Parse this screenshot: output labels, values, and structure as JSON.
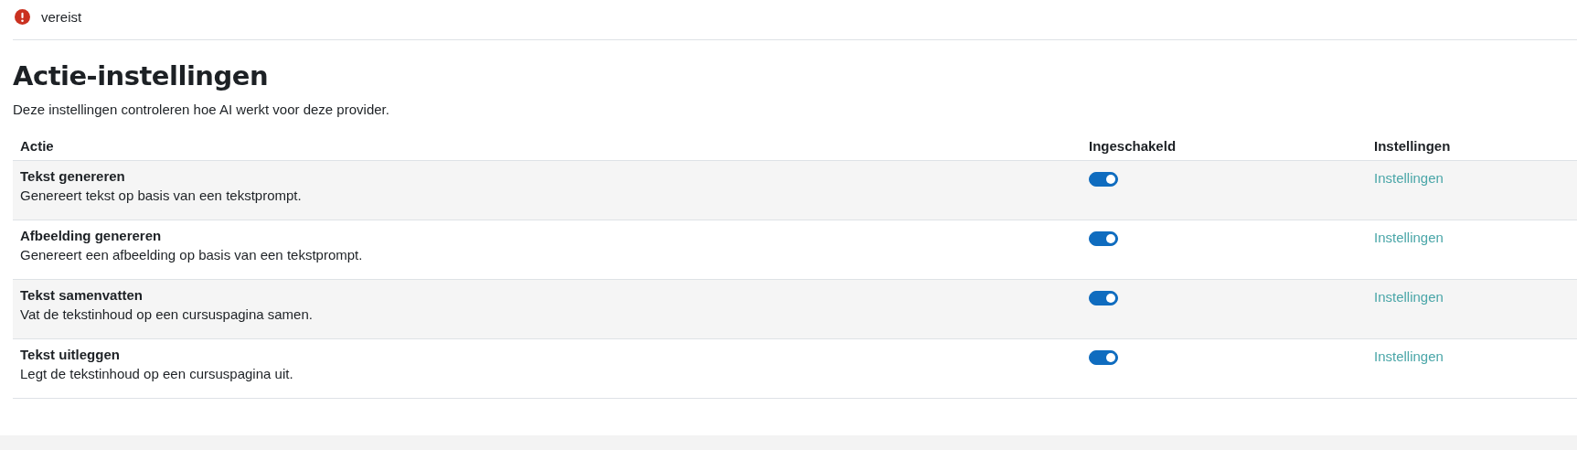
{
  "required_notice": {
    "label": "vereist"
  },
  "section": {
    "title": "Actie-instellingen",
    "description": "Deze instellingen controleren hoe AI werkt voor deze provider."
  },
  "table": {
    "columns": [
      "Actie",
      "Ingeschakeld",
      "Instellingen"
    ],
    "rows": [
      {
        "name": "Tekst genereren",
        "description": "Genereert tekst op basis van een tekstprompt.",
        "enabled": true,
        "link": "Instellingen"
      },
      {
        "name": "Afbeelding genereren",
        "description": "Genereert een afbeelding op basis van een tekstprompt.",
        "enabled": true,
        "link": "Instellingen"
      },
      {
        "name": "Tekst samenvatten",
        "description": "Vat de tekstinhoud op een cursuspagina samen.",
        "enabled": true,
        "link": "Instellingen"
      },
      {
        "name": "Tekst uitleggen",
        "description": "Legt de tekstinhoud op een cursuspagina uit.",
        "enabled": true,
        "link": "Instellingen"
      }
    ]
  }
}
